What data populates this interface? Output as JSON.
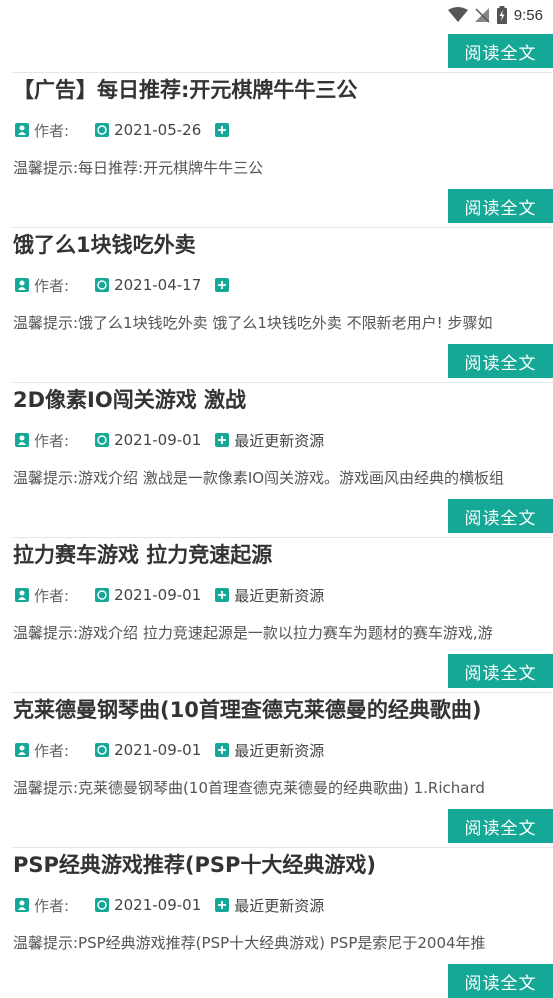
{
  "status_bar": {
    "time": "9:56"
  },
  "read_label": "阅读全文",
  "author_label": "作者:",
  "articles": [
    {
      "title": "【广告】每日推荐:开元棋牌牛牛三公",
      "date": "2021-05-26",
      "tag": "",
      "excerpt": "温馨提示:每日推荐:开元棋牌牛牛三公"
    },
    {
      "title": "饿了么1块钱吃外卖",
      "date": "2021-04-17",
      "tag": "",
      "excerpt": "温馨提示:饿了么1块钱吃外卖 饿了么1块钱吃外卖 不限新老用户! 步骤如"
    },
    {
      "title": "2D像素IO闯关游戏 激战",
      "date": "2021-09-01",
      "tag": "最近更新资源",
      "excerpt": "温馨提示:游戏介绍 激战是一款像素IO闯关游戏。游戏画风由经典的横板组"
    },
    {
      "title": "拉力赛车游戏 拉力竞速起源",
      "date": "2021-09-01",
      "tag": "最近更新资源",
      "excerpt": "温馨提示:游戏介绍 拉力竞速起源是一款以拉力赛车为题材的赛车游戏,游"
    },
    {
      "title": "克莱德曼钢琴曲(10首理查德克莱德曼的经典歌曲)",
      "date": "2021-09-01",
      "tag": "最近更新资源",
      "excerpt": "温馨提示:克莱德曼钢琴曲(10首理查德克莱德曼的经典歌曲) 1.Richard"
    },
    {
      "title": "PSP经典游戏推荐(PSP十大经典游戏)",
      "date": "2021-09-01",
      "tag": "最近更新资源",
      "excerpt": "温馨提示:PSP经典游戏推荐(PSP十大经典游戏) PSP是索尼于2004年推"
    }
  ]
}
